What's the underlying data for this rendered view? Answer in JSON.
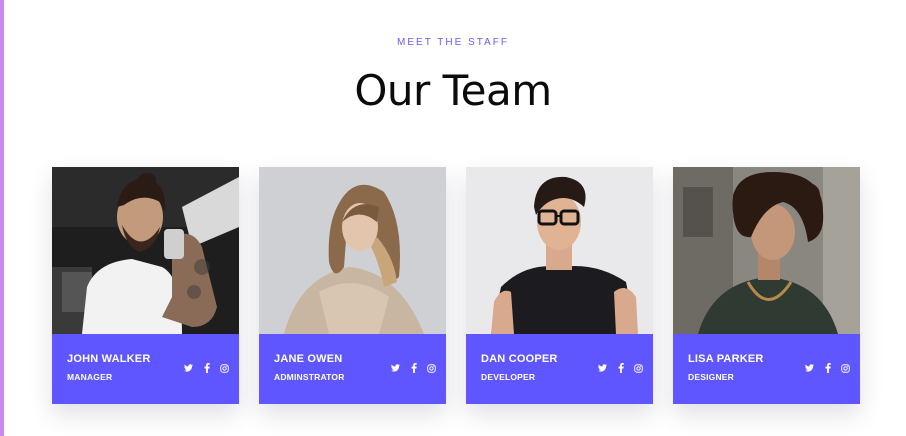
{
  "header": {
    "eyebrow": "MEET THE STAFF",
    "title": "Our Team"
  },
  "colors": {
    "accent": "#5f56ff",
    "eyebrow": "#6c5cf0",
    "stripe": "#c68af0",
    "title": "#0b0b0b"
  },
  "team": [
    {
      "name": "JOHN WALKER",
      "role": "MANAGER",
      "socials": [
        "twitter-icon",
        "facebook-icon",
        "instagram-icon"
      ]
    },
    {
      "name": "JANE OWEN",
      "role": "ADMINSTRATOR",
      "socials": [
        "twitter-icon",
        "facebook-icon",
        "instagram-icon"
      ]
    },
    {
      "name": "DAN COOPER",
      "role": "DEVELOPER",
      "socials": [
        "twitter-icon",
        "facebook-icon",
        "instagram-icon"
      ]
    },
    {
      "name": "LISA PARKER",
      "role": "DESIGNER",
      "socials": [
        "twitter-icon",
        "facebook-icon",
        "instagram-icon"
      ]
    }
  ]
}
